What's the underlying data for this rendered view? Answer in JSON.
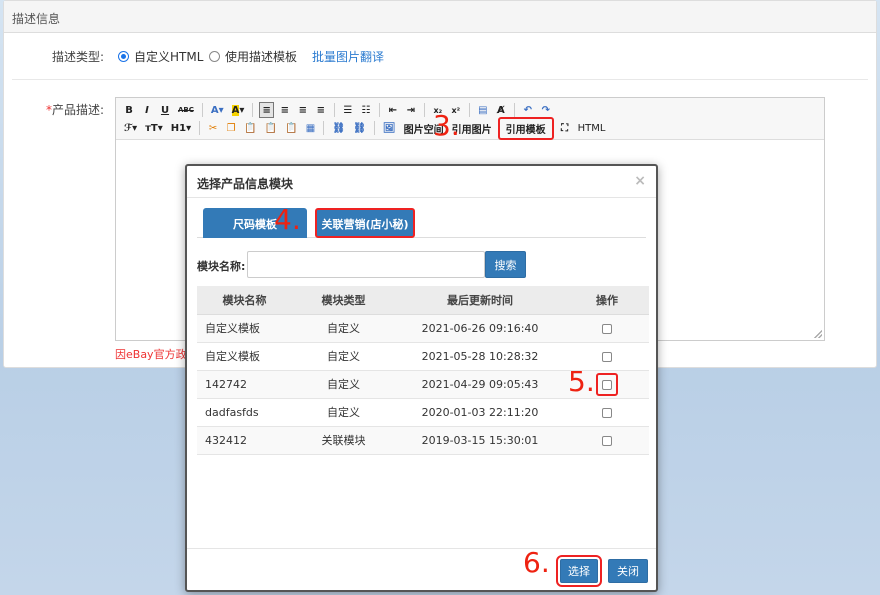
{
  "panel": {
    "heading": "描述信息"
  },
  "desc_type": {
    "label": "描述类型:",
    "options": [
      "自定义HTML",
      "使用描述模板"
    ],
    "selected": "自定义HTML",
    "batch_link": "批量图片翻译"
  },
  "product_desc": {
    "required_mark": "*",
    "label": "产品描述:"
  },
  "toolbar": {
    "row1": [
      "B",
      "I",
      "U",
      "ABC",
      "A",
      "A"
    ],
    "row2": [
      "ℱ",
      "тT",
      "H1"
    ],
    "image_space": "图片空间",
    "ref_image": "引用图片",
    "ref_template": "引用模板",
    "html": "HTML"
  },
  "red_note": "因eBay官方政策",
  "steps": {
    "s3": "3.",
    "s4": "4.",
    "s5": "5.",
    "s6": "6."
  },
  "modal": {
    "title": "选择产品信息模块",
    "close": "×",
    "tabs": [
      "尺码模板",
      "关联营销(店小秘)"
    ],
    "search": {
      "label": "模块名称:",
      "value": "",
      "button": "搜索"
    },
    "table": {
      "headers": [
        "模块名称",
        "模块类型",
        "最后更新时间",
        "操作"
      ],
      "rows": [
        {
          "name": "自定义模板",
          "type": "自定义",
          "time": "2021-06-26 09:16:40",
          "checked": false
        },
        {
          "name": "自定义模板",
          "type": "自定义",
          "time": "2021-05-28 10:28:32",
          "checked": false
        },
        {
          "name": "142742",
          "type": "自定义",
          "time": "2021-04-29 09:05:43",
          "checked": false
        },
        {
          "name": "dadfasfds",
          "type": "自定义",
          "time": "2020-01-03 22:11:20",
          "checked": false
        },
        {
          "name": "432412",
          "type": "关联模块",
          "time": "2019-03-15 15:30:01",
          "checked": false
        }
      ]
    },
    "footer": {
      "select": "选择",
      "close": "关闭"
    }
  },
  "colors": {
    "primary": "#337ab7",
    "annotation": "#e22222",
    "link": "#2b7bd0"
  }
}
